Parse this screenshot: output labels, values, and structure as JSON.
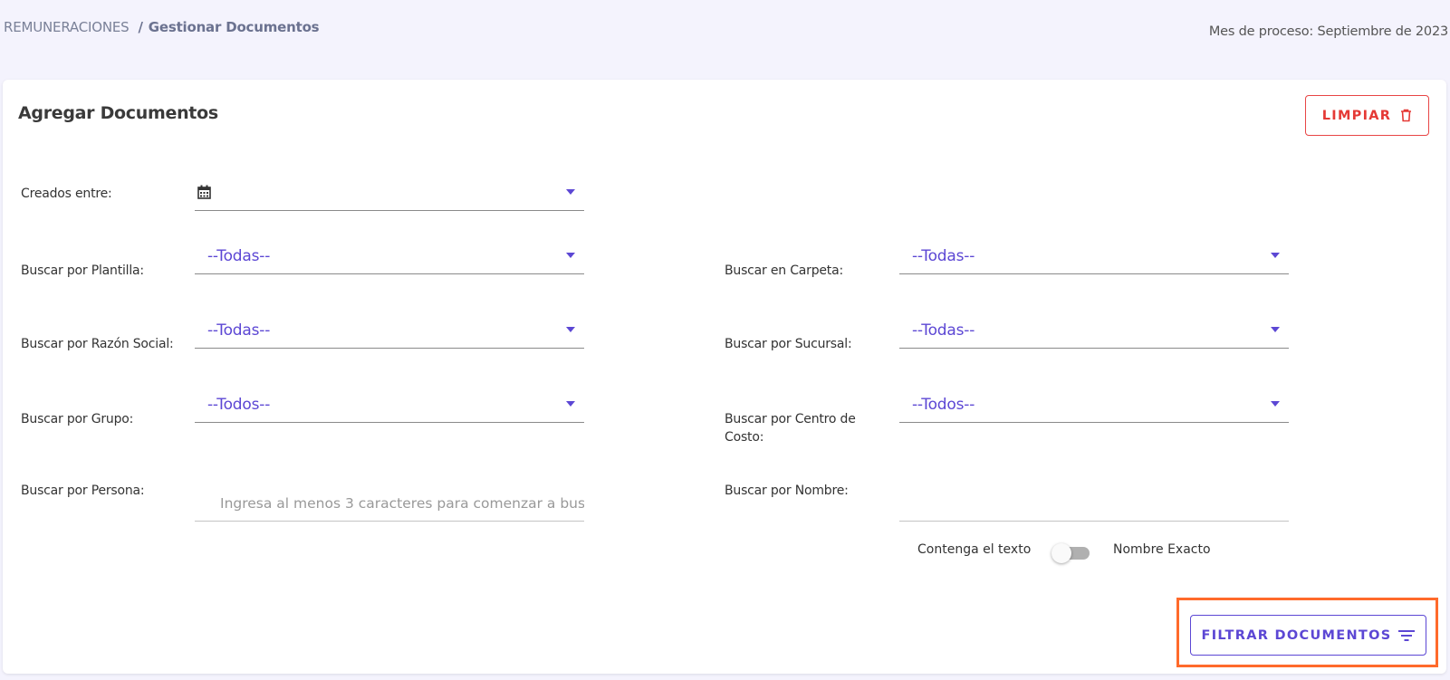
{
  "header": {
    "breadcrumb_root": "REMUNERACIONES",
    "breadcrumb_separator": "/",
    "breadcrumb_current": "Gestionar Documentos",
    "process_month": "Mes de proceso: Septiembre de 2023"
  },
  "card": {
    "title": "Agregar Documentos",
    "clear_button_label": "LIMPIAR",
    "filter_button_label": "FILTRAR DOCUMENTOS"
  },
  "filters": {
    "created_between": {
      "label": "Creados entre:",
      "value": ""
    },
    "template": {
      "label": "Buscar por Plantilla:",
      "value": "--Todas--"
    },
    "folder": {
      "label": "Buscar en Carpeta:",
      "value": "--Todas--"
    },
    "company": {
      "label": "Buscar por Razón Social:",
      "value": "--Todas--"
    },
    "branch": {
      "label": "Buscar por Sucursal:",
      "value": "--Todas--"
    },
    "group": {
      "label": "Buscar por Grupo:",
      "value": "--Todos--"
    },
    "cost_center": {
      "label": "Buscar por Centro de Costo:",
      "value": "--Todos--"
    },
    "person": {
      "label": "Buscar por Persona:",
      "placeholder": "Ingresa al menos 3 caracteres para comenzar a bus",
      "value": ""
    },
    "name": {
      "label": "Buscar por Nombre:",
      "placeholder": "",
      "value": ""
    }
  },
  "name_match_toggle": {
    "left_label": "Contenga el texto",
    "right_label": "Nombre Exacto",
    "state": "off"
  },
  "colors": {
    "accent": "#5c47d4",
    "danger": "#e53935",
    "highlight": "#ff6a2b",
    "background": "#f4f3fd"
  },
  "icons": {
    "clear": "trash-icon",
    "filter": "filter-lines-icon",
    "date": "calendar-icon",
    "dropdown": "caret-down-icon"
  }
}
